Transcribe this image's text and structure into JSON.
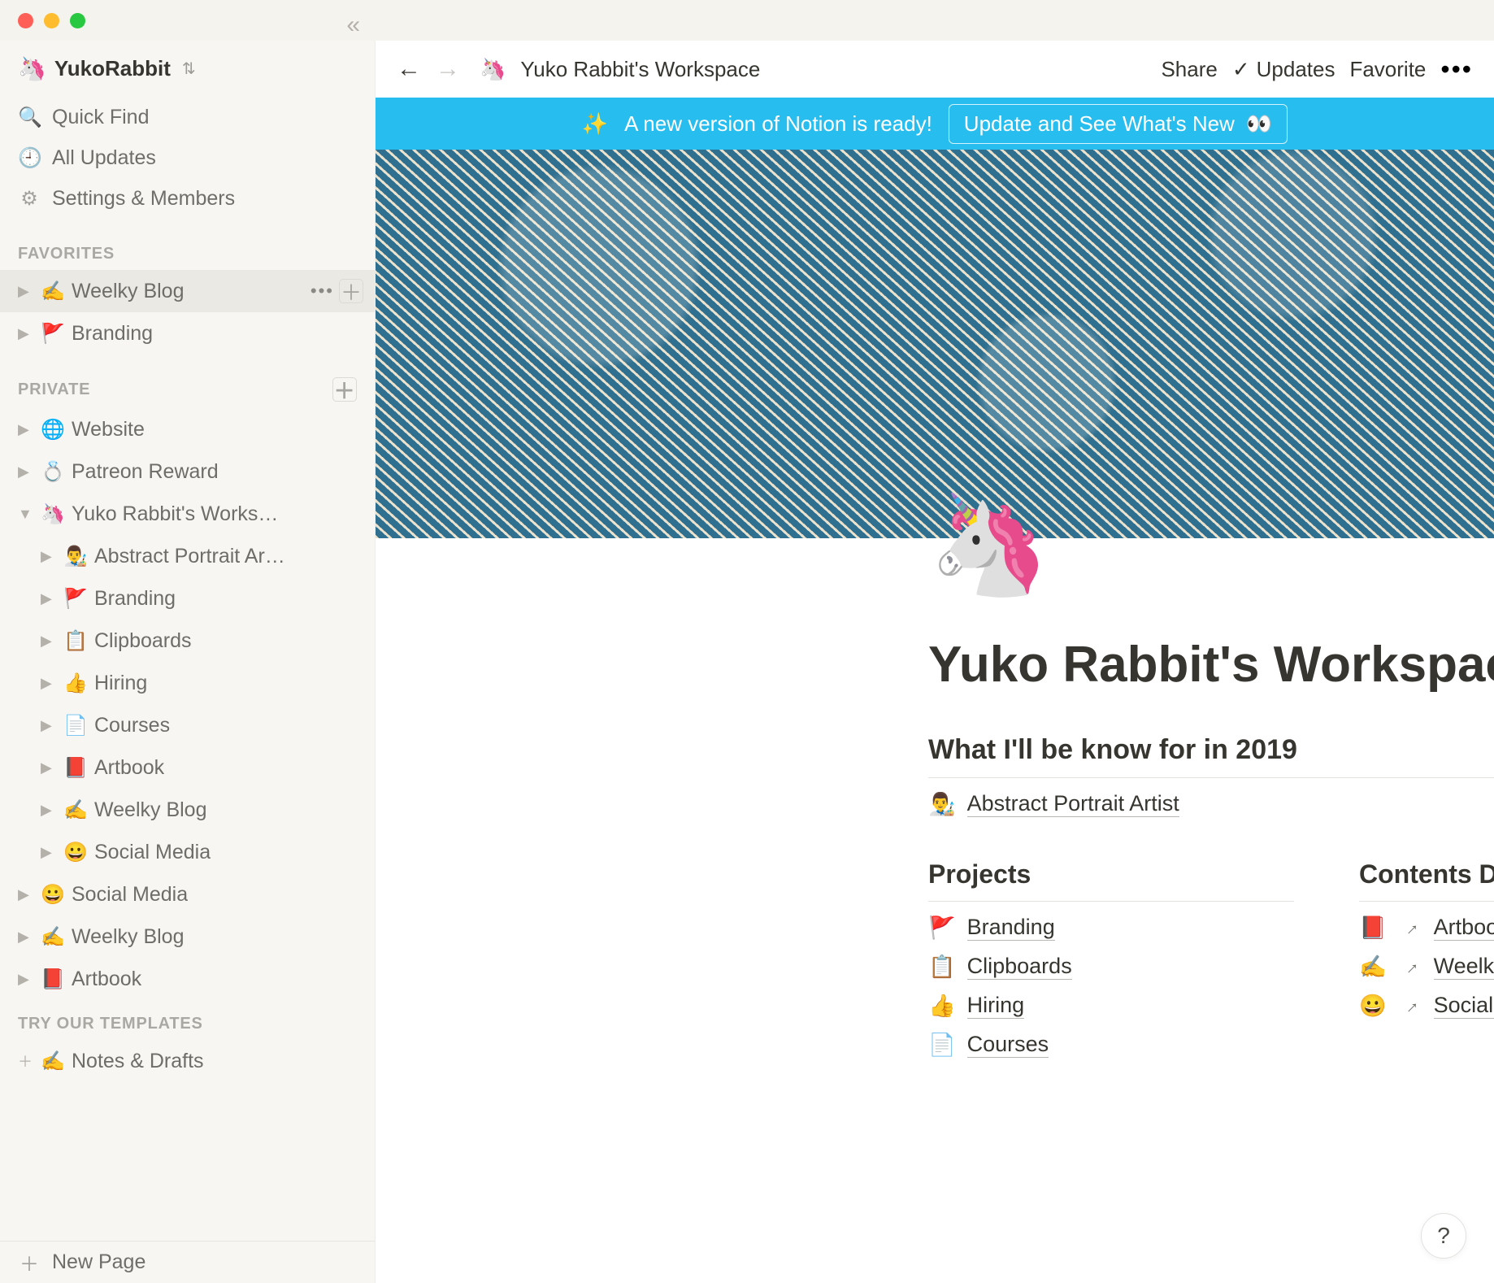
{
  "workspace": {
    "icon": "🦄",
    "name": "YukoRabbit"
  },
  "sidebar": {
    "quick_find": "Quick Find",
    "all_updates": "All Updates",
    "settings": "Settings & Members",
    "favorites_label": "FAVORITES",
    "favorites": [
      {
        "icon": "✍️",
        "label": "Weelky Blog",
        "active": true,
        "actions": true
      },
      {
        "icon": "🚩",
        "label": "Branding"
      }
    ],
    "private_label": "PRIVATE",
    "private": [
      {
        "icon": "🌐",
        "label": "Website"
      },
      {
        "icon": "💍",
        "label": "Patreon Reward"
      },
      {
        "icon": "🦄",
        "label": "Yuko Rabbit's Works…",
        "expanded": true,
        "children": [
          {
            "icon": "👨‍🎨",
            "label": "Abstract Portrait Ar…"
          },
          {
            "icon": "🚩",
            "label": "Branding"
          },
          {
            "icon": "📋",
            "label": "Clipboards"
          },
          {
            "icon": "👍",
            "label": "Hiring"
          },
          {
            "icon": "📄",
            "label": "Courses"
          },
          {
            "icon": "📕",
            "label": "Artbook"
          },
          {
            "icon": "✍️",
            "label": "Weelky Blog"
          },
          {
            "icon": "😀",
            "label": "Social Media"
          }
        ]
      },
      {
        "icon": "😀",
        "label": "Social Media"
      },
      {
        "icon": "✍️",
        "label": "Weelky Blog"
      },
      {
        "icon": "📕",
        "label": "Artbook"
      }
    ],
    "templates_label": "TRY OUR TEMPLATES",
    "templates": [
      {
        "icon": "✍️",
        "label": "Notes & Drafts"
      }
    ],
    "new_page": "New Page"
  },
  "topbar": {
    "breadcrumb_icon": "🦄",
    "breadcrumb": "Yuko Rabbit's Workspace",
    "share": "Share",
    "updates": "Updates",
    "favorite": "Favorite"
  },
  "banner": {
    "sparkle": "✨",
    "text": "A new version of Notion is ready!",
    "button": "Update and See What's New",
    "eyes": "👀"
  },
  "page": {
    "icon": "🦄",
    "title": "Yuko Rabbit's Workspace",
    "subtitle": "What I'll be know for in 2019",
    "feature": {
      "icon": "👨‍🎨",
      "label": "Abstract Portrait Artist"
    },
    "col1": {
      "heading": "Projects",
      "items": [
        {
          "icon": "🚩",
          "label": "Branding"
        },
        {
          "icon": "📋",
          "label": "Clipboards"
        },
        {
          "icon": "👍",
          "label": "Hiring"
        },
        {
          "icon": "📄",
          "label": "Courses"
        }
      ]
    },
    "col2": {
      "heading": "Contents Dashboard",
      "items": [
        {
          "icon": "📕",
          "label": "Artbook"
        },
        {
          "icon": "✍️",
          "label": "Weelky Blog"
        },
        {
          "icon": "😀",
          "label": "Social Media"
        }
      ]
    }
  },
  "help": "?"
}
